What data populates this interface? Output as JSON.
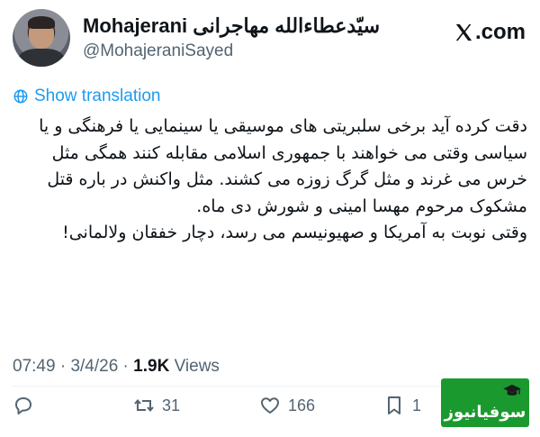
{
  "user": {
    "display_name": "Mohajerani سیّدعطاءالله مهاجرانی",
    "handle": "@MohajeraniSayed"
  },
  "brand": {
    "label": ".com",
    "icon": "x-logo-icon"
  },
  "translation": {
    "label": "Show translation",
    "icon": "translate-icon"
  },
  "tweet": {
    "paragraphs": [
      "دقت کرده آید برخی سلبریتی های موسیقی یا سینمایی یا فرهنگی و یا سیاسی وقتی می خواهند با جمهوری اسلامی مقابله کنند همگی مثل خرس می غرند و مثل گرگ زوزه می کشند. مثل واکنش در باره قتل مشکوک مرحوم مهسا امینی و شورش دی ماه.",
      "وقتی نوبت به آمریکا و صهیونیسم می رسد، دچار خفقان ولالمانی!"
    ]
  },
  "meta": {
    "time": "07:49",
    "sep1": " · ",
    "date": "3/4/26",
    "sep2": " · ",
    "views_count": "1.9K",
    "views_label": " Views"
  },
  "actions": {
    "reply": {
      "icon": "reply-icon",
      "count": ""
    },
    "retweet": {
      "icon": "retweet-icon",
      "count": "31"
    },
    "like": {
      "icon": "heart-icon",
      "count": "166"
    },
    "bookmark": {
      "icon": "bookmark-icon",
      "count": "1"
    }
  },
  "watermark": {
    "text": "سوفیانیوز",
    "color": "#1a9a2e"
  }
}
